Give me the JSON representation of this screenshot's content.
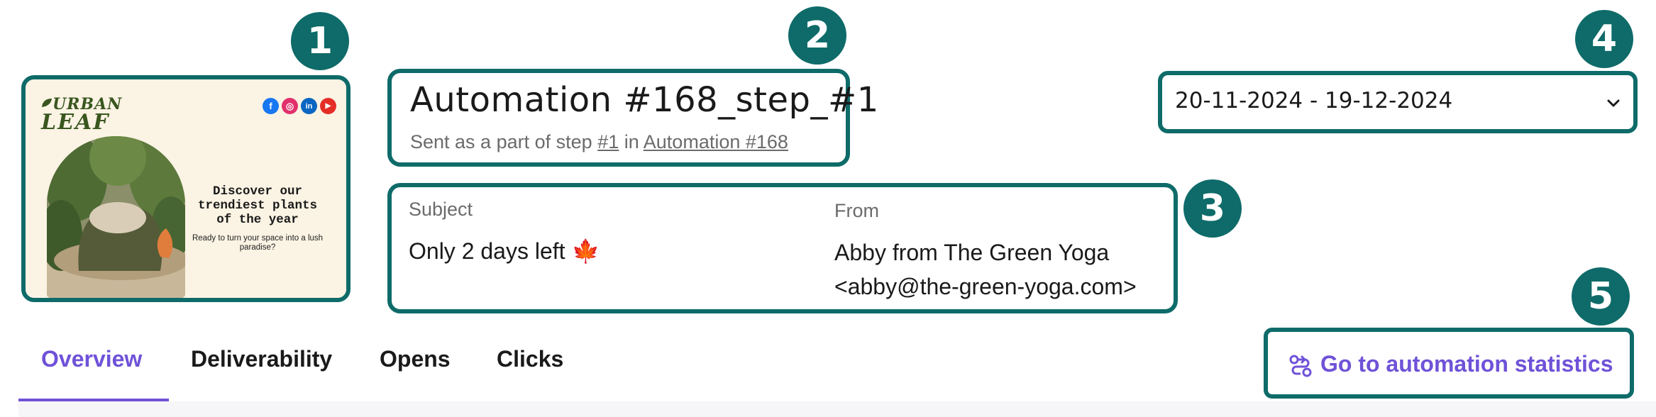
{
  "colors": {
    "frame": "#0e6b69",
    "accent": "#6f52d8",
    "text": "#1a1a1a",
    "muted": "#6b6b6b"
  },
  "badges": [
    "1",
    "2",
    "3",
    "4",
    "5"
  ],
  "email_preview": {
    "logo_line1": "URBAN",
    "logo_line2": "LEAF",
    "social_icons": [
      "facebook-icon",
      "instagram-icon",
      "linkedin-icon",
      "youtube-icon"
    ],
    "social_glyphs": {
      "facebook": "f",
      "instagram": "◎",
      "linkedin": "in",
      "youtube": "▶"
    },
    "headline": "Discover our trendiest plants of the year",
    "subline": "Ready to turn your space into a lush paradise?"
  },
  "header": {
    "title": "Automation #168_step_#1",
    "subtitle_prefix": "Sent as a part of step",
    "step_link": "#1",
    "subtitle_mid": "in",
    "automation_link": "Automation #168"
  },
  "details": {
    "subject_label": "Subject",
    "subject_value": "Only 2 days left 🍁",
    "from_label": "From",
    "from_name": "Abby from The Green Yoga",
    "from_email": "<abby@the-green-yoga.com>"
  },
  "date_range": {
    "value": "20-11-2024 - 19-12-2024",
    "icon": "chevron-down-icon"
  },
  "tabs": [
    {
      "label": "Overview",
      "active": true
    },
    {
      "label": "Deliverability",
      "active": false
    },
    {
      "label": "Opens",
      "active": false
    },
    {
      "label": "Clicks",
      "active": false
    }
  ],
  "stats_button": {
    "label": "Go to automation statistics",
    "icon": "automation-flow-icon"
  }
}
